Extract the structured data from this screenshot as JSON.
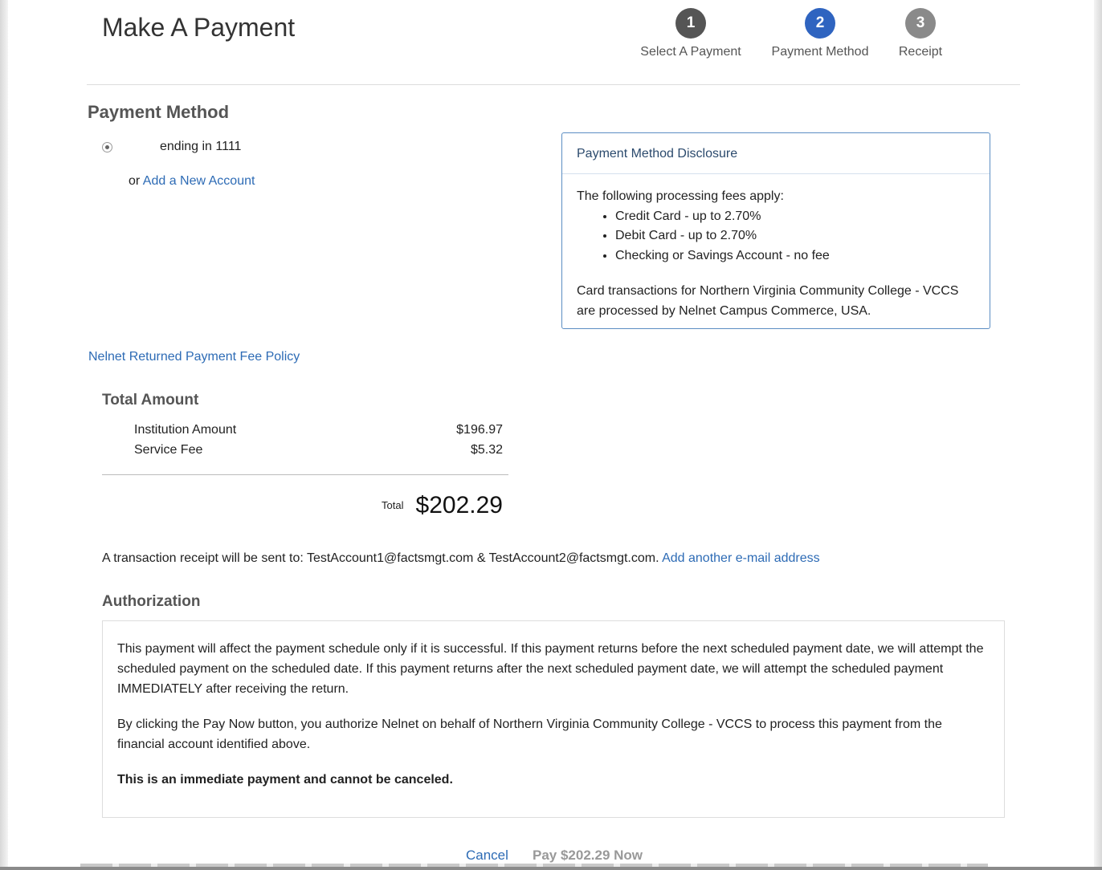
{
  "header": {
    "title": "Make A Payment",
    "steps": [
      {
        "number": "1",
        "label": "Select A Payment",
        "color": "#555555"
      },
      {
        "number": "2",
        "label": "Payment Method",
        "color": "#2f64c0"
      },
      {
        "number": "3",
        "label": "Receipt",
        "color": "#8a8a8a"
      }
    ],
    "active_step": 2
  },
  "payment_method": {
    "heading": "Payment Method",
    "account_label": "ending in 1111",
    "or_text": "or",
    "add_account_link": "Add a New Account"
  },
  "disclosure": {
    "title": "Payment Method Disclosure",
    "intro": "The following processing fees apply:",
    "fees": [
      "Credit Card - up to 2.70%",
      "Debit Card - up to 2.70%",
      "Checking or Savings Account - no fee"
    ],
    "note": "Card transactions for Northern Virginia Community College - VCCS are processed by Nelnet Campus Commerce, USA."
  },
  "fee_policy_link": "Nelnet Returned Payment Fee Policy",
  "total_amount": {
    "heading": "Total Amount",
    "rows": [
      {
        "label": "Institution Amount",
        "value": "$196.97"
      },
      {
        "label": "Service Fee",
        "value": "$5.32"
      }
    ],
    "total_label": "Total",
    "total_value": "$202.29"
  },
  "receipt": {
    "text": "A transaction receipt will be sent to: TestAccount1@factsmgt.com & TestAccount2@factsmgt.com.",
    "add_email_link": "Add another e-mail address"
  },
  "authorization": {
    "heading": "Authorization",
    "paragraph1": "This payment will affect the payment schedule only if it is successful. If this payment returns before the next scheduled payment date, we will attempt the scheduled payment on the scheduled date. If this payment returns after the next scheduled payment date, we will attempt the scheduled payment IMMEDIATELY after receiving the return.",
    "paragraph2": "By clicking the Pay Now button, you authorize Nelnet on behalf of Northern Virginia Community College - VCCS to process this payment from the financial account identified above.",
    "paragraph3": "This is an immediate payment and cannot be canceled."
  },
  "actions": {
    "cancel_label": "Cancel",
    "pay_label": "Pay $202.29 Now"
  },
  "colors": {
    "link": "#2d6bb5",
    "active_step": "#2f64c0",
    "disclosure_border": "#5b8dc3"
  }
}
